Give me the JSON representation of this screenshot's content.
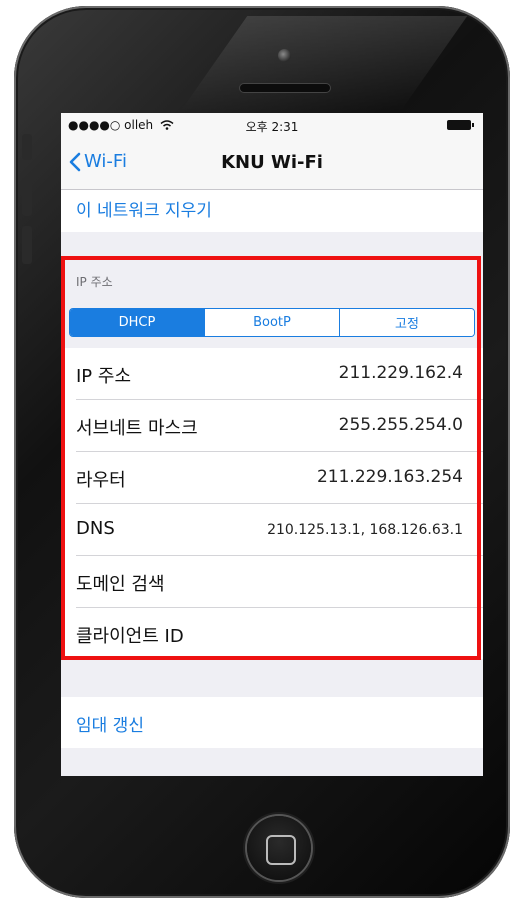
{
  "status_bar": {
    "carrier": "●●●●○ olleh",
    "time": "오후 2:31"
  },
  "nav": {
    "back_label": "Wi-Fi",
    "title": "KNU Wi-Fi"
  },
  "forget_network": "이 네트워크 지우기",
  "ip_section": {
    "header": "IP 주소",
    "segments": [
      "DHCP",
      "BootP",
      "고정"
    ],
    "selected_segment": "DHCP",
    "rows": [
      {
        "label": "IP 주소",
        "value": "211.229.162.4"
      },
      {
        "label": "서브네트 마스크",
        "value": "255.255.254.0"
      },
      {
        "label": "라우터",
        "value": "211.229.163.254"
      },
      {
        "label": "DNS",
        "value": "210.125.13.1, 168.126.63.1"
      },
      {
        "label": "도메인 검색",
        "value": ""
      },
      {
        "label": "클라이언트 ID",
        "value": ""
      }
    ]
  },
  "renew_lease": "임대 갱신",
  "colors": {
    "accent": "#1a7de0",
    "highlight_border": "#ee1111"
  }
}
